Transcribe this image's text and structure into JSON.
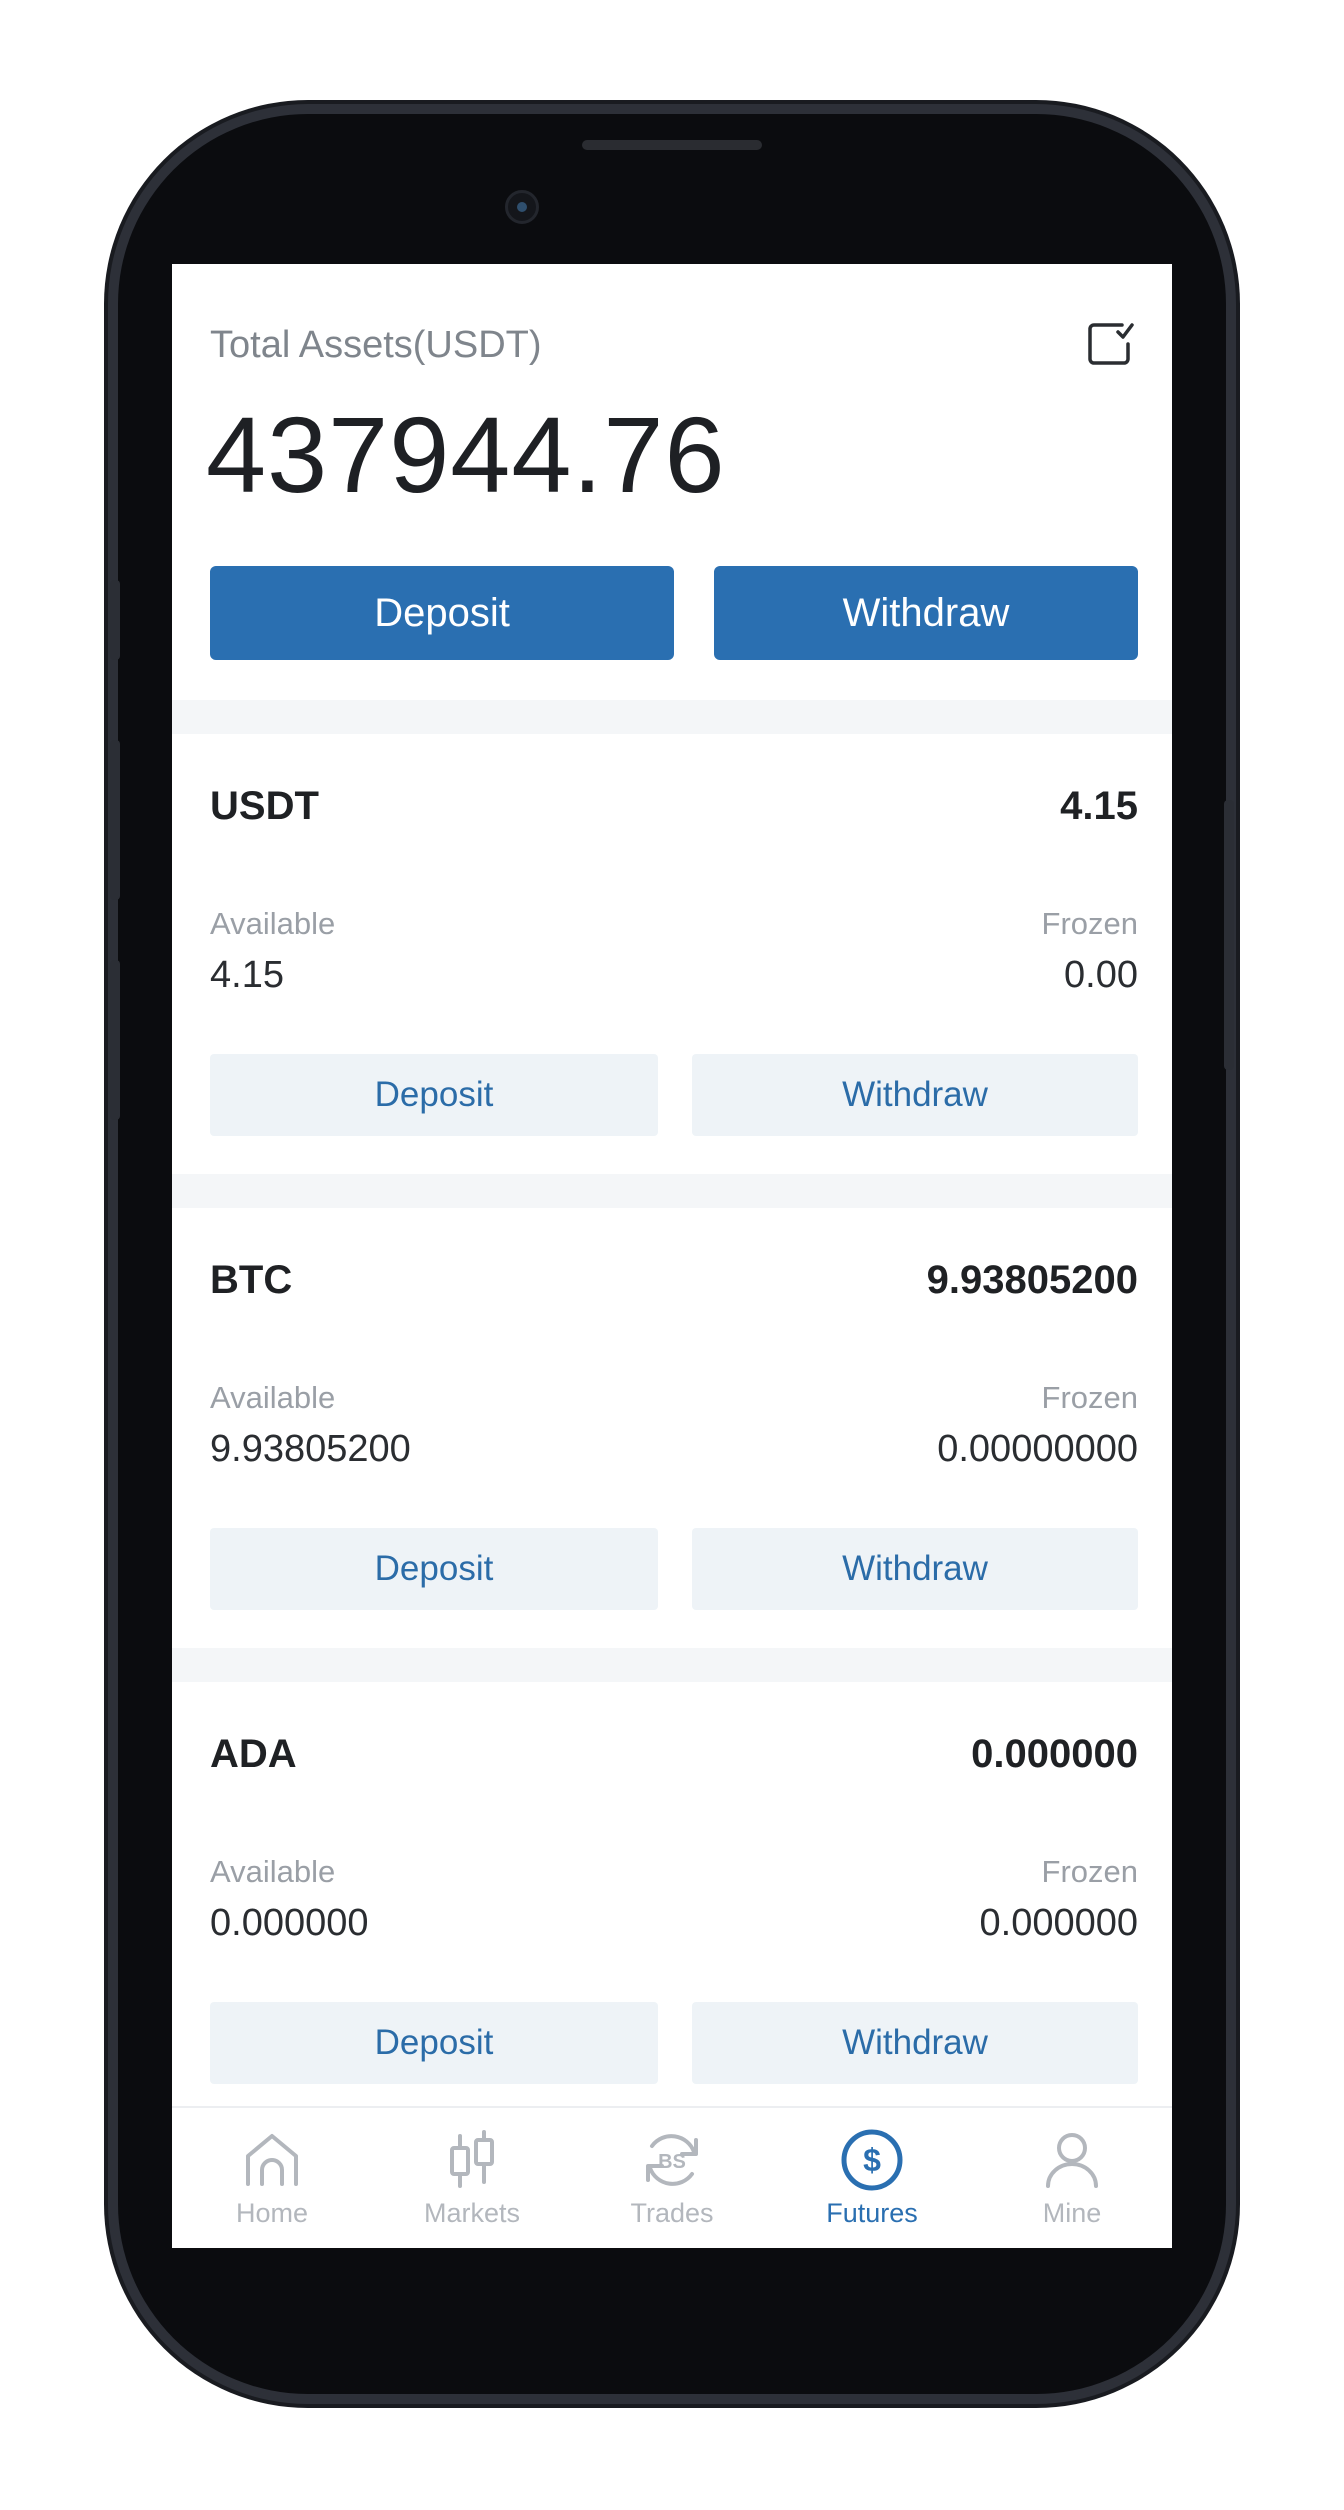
{
  "assets": {
    "total_label": "Total Assets(USDT)",
    "total_value": "437944.76",
    "deposit_label": "Deposit",
    "withdraw_label": "Withdraw"
  },
  "coins": [
    {
      "name": "USDT",
      "total": "4.15",
      "available_label": "Available",
      "available": "4.15",
      "frozen_label": "Frozen",
      "frozen": "0.00",
      "deposit_label": "Deposit",
      "withdraw_label": "Withdraw"
    },
    {
      "name": "BTC",
      "total": "9.93805200",
      "available_label": "Available",
      "available": "9.93805200",
      "frozen_label": "Frozen",
      "frozen": "0.00000000",
      "deposit_label": "Deposit",
      "withdraw_label": "Withdraw"
    },
    {
      "name": "ADA",
      "total": "0.000000",
      "available_label": "Available",
      "available": "0.000000",
      "frozen_label": "Frozen",
      "frozen": "0.000000",
      "deposit_label": "Deposit",
      "withdraw_label": "Withdraw"
    }
  ],
  "nav": {
    "items": [
      {
        "label": "Home",
        "icon": "home-icon",
        "active": false
      },
      {
        "label": "Markets",
        "icon": "candlestick-icon",
        "active": false
      },
      {
        "label": "Trades",
        "icon": "bs-exchange-icon",
        "active": false
      },
      {
        "label": "Futures",
        "icon": "dollar-circle-icon",
        "active": true
      },
      {
        "label": "Mine",
        "icon": "user-icon",
        "active": false
      }
    ]
  },
  "colors": {
    "primary": "#2a6fb1",
    "soft_button_bg": "#eef3f7",
    "divider": "#f4f6f8",
    "nav_inactive": "#b3b7bd"
  }
}
